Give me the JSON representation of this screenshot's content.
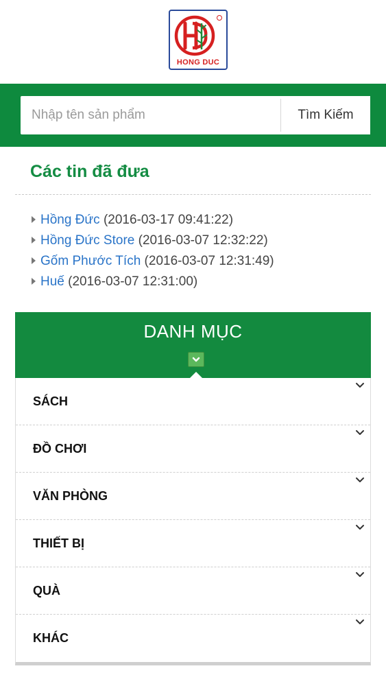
{
  "logo": {
    "brand_text": "HONG DUC",
    "registered_mark": "®"
  },
  "search": {
    "placeholder": "Nhập tên sản phẩm",
    "value": "",
    "button_label": "Tìm Kiếm"
  },
  "recent": {
    "title": "Các tin đã đưa",
    "items": [
      {
        "name": "Hồng Đức",
        "date": "(2016-03-17 09:41:22)"
      },
      {
        "name": "Hồng Đức Store",
        "date": "(2016-03-07 12:32:22)"
      },
      {
        "name": "Gốm Phước Tích",
        "date": "(2016-03-07 12:31:49)"
      },
      {
        "name": "Huế",
        "date": "(2016-03-07 12:31:00)"
      }
    ]
  },
  "menu": {
    "title": "DANH MỤC",
    "toggle_icon": "chevron-down-icon",
    "items": [
      {
        "label": "SÁCH"
      },
      {
        "label": "ĐỒ CHƠI"
      },
      {
        "label": "VĂN PHÒNG"
      },
      {
        "label": "THIẾT BỊ"
      },
      {
        "label": "QUÀ"
      },
      {
        "label": "KHÁC"
      }
    ]
  },
  "colors": {
    "brand_green": "#0e8a3e",
    "heading_green": "#148c43",
    "link_blue": "#2a74c8",
    "logo_red": "#d62020",
    "logo_border_blue": "#2a4a9a"
  }
}
